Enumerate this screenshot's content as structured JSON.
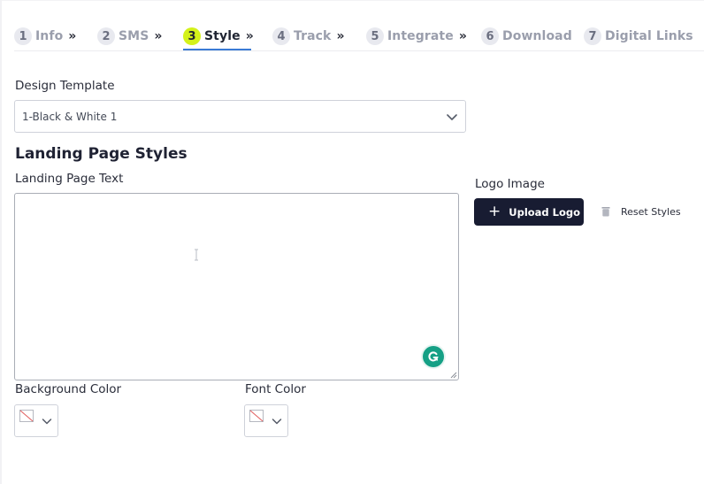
{
  "steps": [
    {
      "num": "1",
      "label": "Info",
      "chevron": "»"
    },
    {
      "num": "2",
      "label": "SMS",
      "chevron": "»"
    },
    {
      "num": "3",
      "label": "Style",
      "chevron": "»"
    },
    {
      "num": "4",
      "label": "Track",
      "chevron": "»"
    },
    {
      "num": "5",
      "label": "Integrate",
      "chevron": "»"
    },
    {
      "num": "6",
      "label": "Download"
    },
    {
      "num": "7",
      "label": "Digital Links"
    }
  ],
  "active_step": "Style",
  "design_template": {
    "label": "Design Template",
    "value": "1-Black & White 1"
  },
  "section_title": "Landing Page Styles",
  "landing_page_text": {
    "label": "Landing Page Text",
    "value": ""
  },
  "logo": {
    "label": "Logo Image",
    "upload_button": "Upload Logo",
    "reset_button": "Reset Styles"
  },
  "background_color": {
    "label": "Background Color"
  },
  "font_color": {
    "label": "Font Color"
  },
  "icons": {
    "step_separator": "chevron-double-right-icon",
    "select_arrow": "chevron-down-icon",
    "upload": "plus-icon",
    "reset": "trash-icon",
    "grammarly": "grammarly-icon",
    "swatch": "no-color-icon"
  },
  "colors": {
    "active_step": "#d4f21a",
    "primary_button": "#181c32",
    "step_underline": "#3a7bd5",
    "grammarly": "#15a085"
  }
}
